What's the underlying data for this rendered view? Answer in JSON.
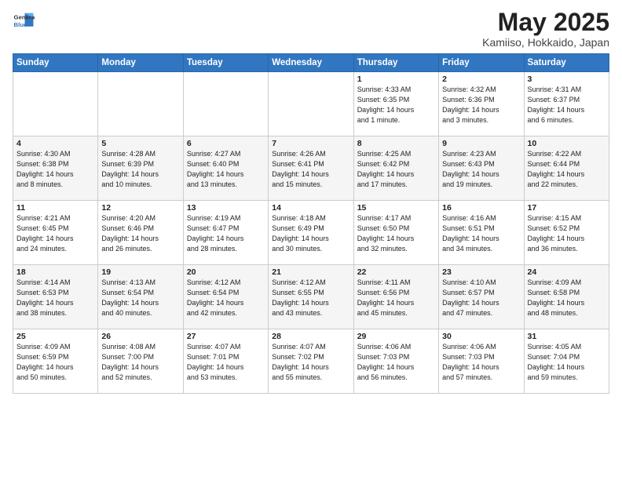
{
  "logo": {
    "general": "General",
    "blue": "Blue"
  },
  "title": {
    "month": "May 2025",
    "location": "Kamiiso, Hokkaido, Japan"
  },
  "weekdays": [
    "Sunday",
    "Monday",
    "Tuesday",
    "Wednesday",
    "Thursday",
    "Friday",
    "Saturday"
  ],
  "weeks": [
    [
      {
        "day": "",
        "info": ""
      },
      {
        "day": "",
        "info": ""
      },
      {
        "day": "",
        "info": ""
      },
      {
        "day": "",
        "info": ""
      },
      {
        "day": "1",
        "info": "Sunrise: 4:33 AM\nSunset: 6:35 PM\nDaylight: 14 hours\nand 1 minute."
      },
      {
        "day": "2",
        "info": "Sunrise: 4:32 AM\nSunset: 6:36 PM\nDaylight: 14 hours\nand 3 minutes."
      },
      {
        "day": "3",
        "info": "Sunrise: 4:31 AM\nSunset: 6:37 PM\nDaylight: 14 hours\nand 6 minutes."
      }
    ],
    [
      {
        "day": "4",
        "info": "Sunrise: 4:30 AM\nSunset: 6:38 PM\nDaylight: 14 hours\nand 8 minutes."
      },
      {
        "day": "5",
        "info": "Sunrise: 4:28 AM\nSunset: 6:39 PM\nDaylight: 14 hours\nand 10 minutes."
      },
      {
        "day": "6",
        "info": "Sunrise: 4:27 AM\nSunset: 6:40 PM\nDaylight: 14 hours\nand 13 minutes."
      },
      {
        "day": "7",
        "info": "Sunrise: 4:26 AM\nSunset: 6:41 PM\nDaylight: 14 hours\nand 15 minutes."
      },
      {
        "day": "8",
        "info": "Sunrise: 4:25 AM\nSunset: 6:42 PM\nDaylight: 14 hours\nand 17 minutes."
      },
      {
        "day": "9",
        "info": "Sunrise: 4:23 AM\nSunset: 6:43 PM\nDaylight: 14 hours\nand 19 minutes."
      },
      {
        "day": "10",
        "info": "Sunrise: 4:22 AM\nSunset: 6:44 PM\nDaylight: 14 hours\nand 22 minutes."
      }
    ],
    [
      {
        "day": "11",
        "info": "Sunrise: 4:21 AM\nSunset: 6:45 PM\nDaylight: 14 hours\nand 24 minutes."
      },
      {
        "day": "12",
        "info": "Sunrise: 4:20 AM\nSunset: 6:46 PM\nDaylight: 14 hours\nand 26 minutes."
      },
      {
        "day": "13",
        "info": "Sunrise: 4:19 AM\nSunset: 6:47 PM\nDaylight: 14 hours\nand 28 minutes."
      },
      {
        "day": "14",
        "info": "Sunrise: 4:18 AM\nSunset: 6:49 PM\nDaylight: 14 hours\nand 30 minutes."
      },
      {
        "day": "15",
        "info": "Sunrise: 4:17 AM\nSunset: 6:50 PM\nDaylight: 14 hours\nand 32 minutes."
      },
      {
        "day": "16",
        "info": "Sunrise: 4:16 AM\nSunset: 6:51 PM\nDaylight: 14 hours\nand 34 minutes."
      },
      {
        "day": "17",
        "info": "Sunrise: 4:15 AM\nSunset: 6:52 PM\nDaylight: 14 hours\nand 36 minutes."
      }
    ],
    [
      {
        "day": "18",
        "info": "Sunrise: 4:14 AM\nSunset: 6:53 PM\nDaylight: 14 hours\nand 38 minutes."
      },
      {
        "day": "19",
        "info": "Sunrise: 4:13 AM\nSunset: 6:54 PM\nDaylight: 14 hours\nand 40 minutes."
      },
      {
        "day": "20",
        "info": "Sunrise: 4:12 AM\nSunset: 6:54 PM\nDaylight: 14 hours\nand 42 minutes."
      },
      {
        "day": "21",
        "info": "Sunrise: 4:12 AM\nSunset: 6:55 PM\nDaylight: 14 hours\nand 43 minutes."
      },
      {
        "day": "22",
        "info": "Sunrise: 4:11 AM\nSunset: 6:56 PM\nDaylight: 14 hours\nand 45 minutes."
      },
      {
        "day": "23",
        "info": "Sunrise: 4:10 AM\nSunset: 6:57 PM\nDaylight: 14 hours\nand 47 minutes."
      },
      {
        "day": "24",
        "info": "Sunrise: 4:09 AM\nSunset: 6:58 PM\nDaylight: 14 hours\nand 48 minutes."
      }
    ],
    [
      {
        "day": "25",
        "info": "Sunrise: 4:09 AM\nSunset: 6:59 PM\nDaylight: 14 hours\nand 50 minutes."
      },
      {
        "day": "26",
        "info": "Sunrise: 4:08 AM\nSunset: 7:00 PM\nDaylight: 14 hours\nand 52 minutes."
      },
      {
        "day": "27",
        "info": "Sunrise: 4:07 AM\nSunset: 7:01 PM\nDaylight: 14 hours\nand 53 minutes."
      },
      {
        "day": "28",
        "info": "Sunrise: 4:07 AM\nSunset: 7:02 PM\nDaylight: 14 hours\nand 55 minutes."
      },
      {
        "day": "29",
        "info": "Sunrise: 4:06 AM\nSunset: 7:03 PM\nDaylight: 14 hours\nand 56 minutes."
      },
      {
        "day": "30",
        "info": "Sunrise: 4:06 AM\nSunset: 7:03 PM\nDaylight: 14 hours\nand 57 minutes."
      },
      {
        "day": "31",
        "info": "Sunrise: 4:05 AM\nSunset: 7:04 PM\nDaylight: 14 hours\nand 59 minutes."
      }
    ]
  ]
}
